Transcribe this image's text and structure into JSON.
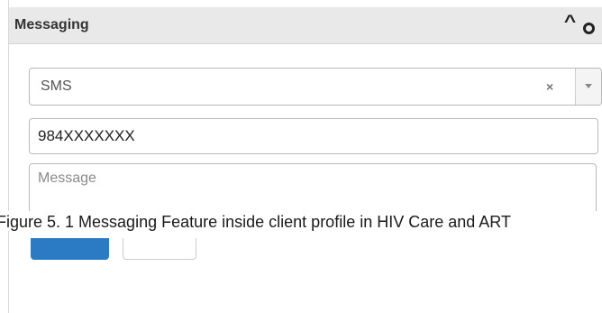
{
  "panel": {
    "title": "Messaging"
  },
  "channel_select": {
    "selected": "SMS",
    "clear_glyph": "×"
  },
  "phone_field": {
    "value": "984XXXXXXX"
  },
  "message_field": {
    "placeholder": "Message"
  },
  "caption": {
    "text": "Figure 5. 1 Messaging Feature inside client profile in HIV Care and ART"
  },
  "icons": {
    "collapse": "chevron-up-icon",
    "close": "circle-close-icon",
    "clear": "clear-icon",
    "dropdown": "caret-down-icon"
  },
  "colors": {
    "header_bg": "#e9e9e9",
    "primary_button": "#2a7bc4",
    "border": "#b9b9b9"
  }
}
